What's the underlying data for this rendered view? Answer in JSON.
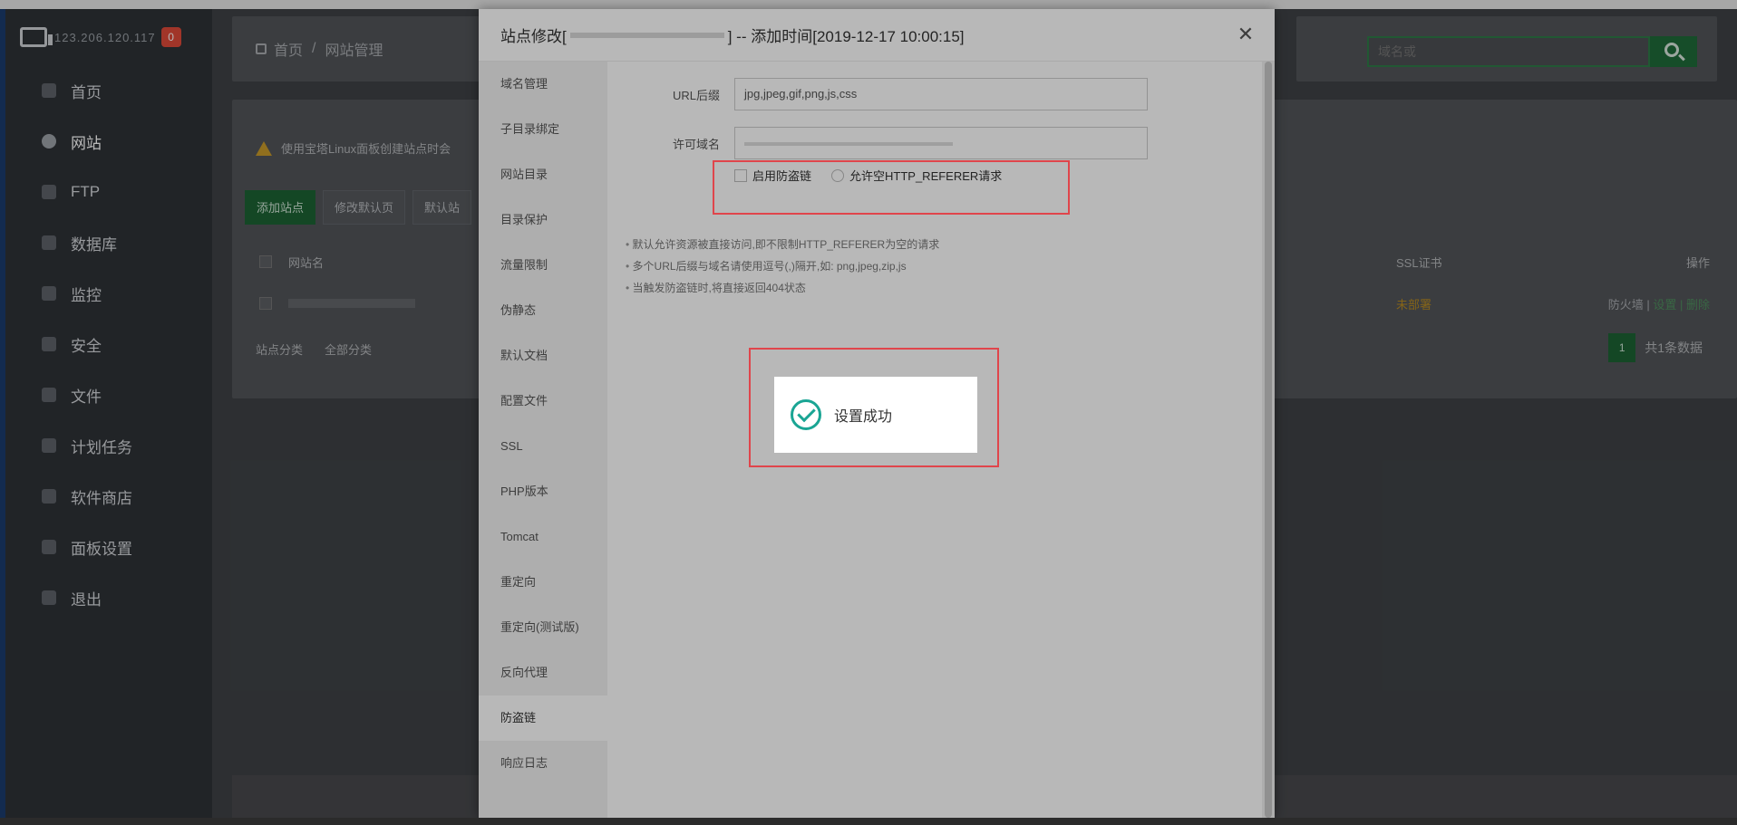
{
  "sidebar": {
    "ip": "123.206.120.117",
    "badge": "0",
    "items": [
      {
        "label": "首页",
        "icon": "home-icon"
      },
      {
        "label": "网站",
        "icon": "globe-icon",
        "active": true
      },
      {
        "label": "FTP",
        "icon": "ftp-icon"
      },
      {
        "label": "数据库",
        "icon": "database-icon"
      },
      {
        "label": "监控",
        "icon": "monitor-icon"
      },
      {
        "label": "安全",
        "icon": "shield-icon"
      },
      {
        "label": "文件",
        "icon": "folder-icon"
      },
      {
        "label": "计划任务",
        "icon": "clock-icon"
      },
      {
        "label": "软件商店",
        "icon": "store-icon"
      },
      {
        "label": "面板设置",
        "icon": "gear-icon"
      },
      {
        "label": "退出",
        "icon": "logout-icon"
      }
    ]
  },
  "header": {
    "breadcrumb_home": "首页",
    "breadcrumb_sep": "/",
    "breadcrumb_current": "网站管理",
    "search_placeholder": "域名或"
  },
  "content": {
    "warning": "使用宝塔Linux面板创建站点时会",
    "buttons": [
      "添加站点",
      "修改默认页",
      "默认站"
    ],
    "table": {
      "col_name": "网站名",
      "col_ssl": "SSL证书",
      "col_op": "操作",
      "row_ssl": "未部署",
      "row_ops_prefix": "防火墙 | ",
      "row_ops_links": "设置 | 删除"
    },
    "filter_label": "站点分类",
    "filter_value": "全部分类",
    "pager_page": "1",
    "pager_total": "共1条数据"
  },
  "modal": {
    "title_prefix": "站点修改[",
    "title_suffix": "] -- 添加时间[2019-12-17 10:00:15]",
    "close": "✕",
    "tabs": [
      "域名管理",
      "子目录绑定",
      "网站目录",
      "目录保护",
      "流量限制",
      "伪静态",
      "默认文档",
      "配置文件",
      "SSL",
      "PHP版本",
      "Tomcat",
      "重定向",
      "重定向(测试版)",
      "反向代理",
      "防盗链",
      "响应日志"
    ],
    "active_tab": "防盗链",
    "url_suffix_label": "URL后缀",
    "url_suffix_value": "jpg,jpeg,gif,png,js,css",
    "allowed_domains_label": "许可域名",
    "check_enable": "启用防盗链",
    "check_allow_empty": "允许空HTTP_REFERER请求",
    "tips": [
      "默认允许资源被直接访问,即不限制HTTP_REFERER为空的请求",
      "多个URL后缀与域名请使用逗号(,)隔开,如: png,jpeg,zip,js",
      "当触发防盗链时,将直接返回404状态"
    ]
  },
  "toast": {
    "message": "设置成功"
  },
  "colors": {
    "accent_green": "#1d6334",
    "highlight_red": "#e0454b",
    "success_teal": "#1aa594",
    "warning_amber": "#b88b22"
  }
}
